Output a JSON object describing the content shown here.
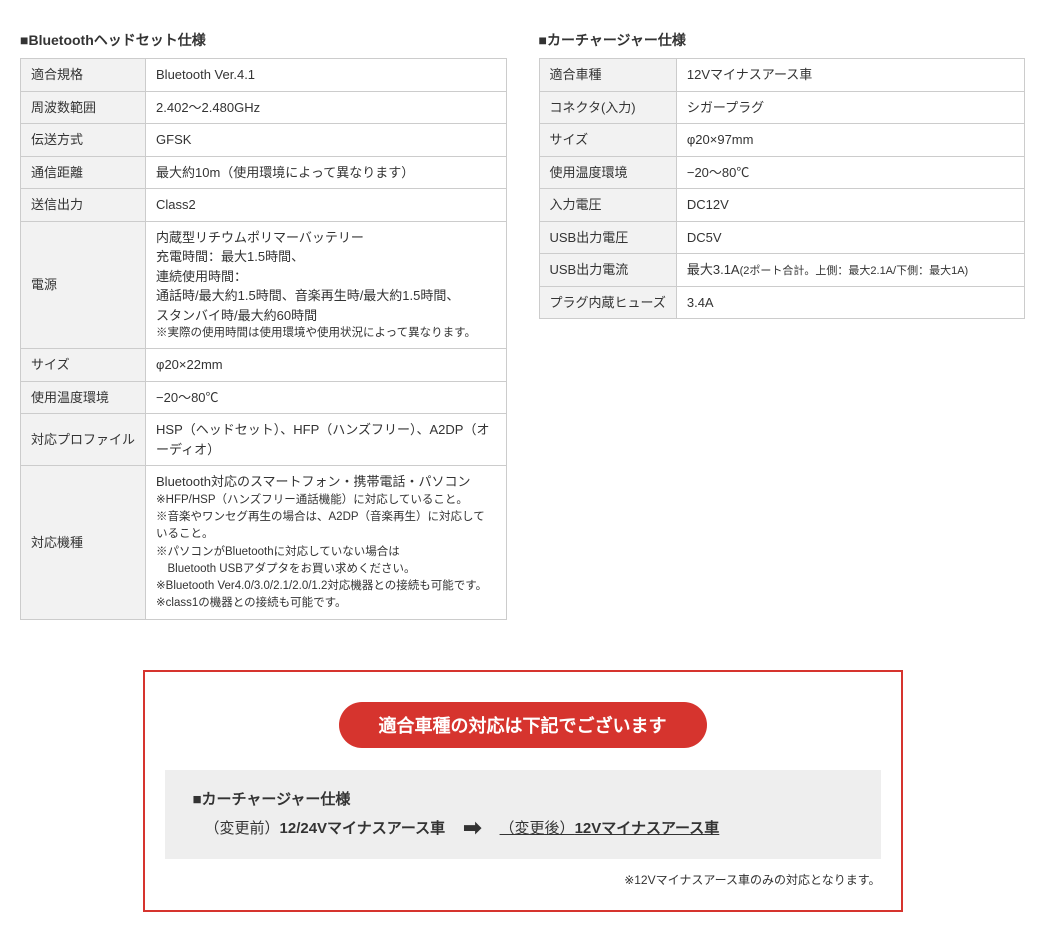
{
  "left": {
    "title": "■Bluetoothヘッドセット仕様",
    "rows": [
      {
        "k": "適合規格",
        "v": "Bluetooth Ver.4.1"
      },
      {
        "k": "周波数範囲",
        "v": "2.402～2.480GHz"
      },
      {
        "k": "伝送方式",
        "v": "GFSK"
      },
      {
        "k": "通信距離",
        "v": "最大約10m（使用環境によって異なります）"
      },
      {
        "k": "送信出力",
        "v": "Class2"
      }
    ],
    "power": {
      "k": "電源",
      "lines": [
        "内蔵型リチウムポリマーバッテリー",
        "充電時間：最大1.5時間、",
        "連続使用時間：",
        "通話時/最大約1.5時間、音楽再生時/最大約1.5時間、",
        "スタンバイ時/最大約60時間"
      ],
      "note": "※実際の使用時間は使用環境や使用状況によって異なります。"
    },
    "rows2": [
      {
        "k": "サイズ",
        "v": "φ20×22mm"
      },
      {
        "k": "使用温度環境",
        "v": "−20～80℃"
      },
      {
        "k": "対応プロファイル",
        "v": "HSP（ヘッドセット）、HFP（ハンズフリー）、A2DP（オーディオ）"
      }
    ],
    "models": {
      "k": "対応機種",
      "main": "Bluetooth対応のスマートフォン・携帯電話・パソコン",
      "notes": [
        "※HFP/HSP（ハンズフリー通話機能）に対応していること。",
        "※音楽やワンセグ再生の場合は、A2DP（音楽再生）に対応していること。",
        "※パソコンがBluetoothに対応していない場合は",
        "　Bluetooth USBアダプタをお買い求めください。",
        "※Bluetooth Ver4.0/3.0/2.1/2.0/1.2対応機器との接続も可能です。",
        "※class1の機器との接続も可能です。"
      ]
    }
  },
  "right": {
    "title": "■カーチャージャー仕様",
    "rows": [
      {
        "k": "適合車種",
        "v": "12Vマイナスアース車"
      },
      {
        "k": "コネクタ(入力)",
        "v": "シガープラグ"
      },
      {
        "k": "サイズ",
        "v": "φ20×97mm"
      },
      {
        "k": "使用温度環境",
        "v": "−20～80℃"
      },
      {
        "k": "入力電圧",
        "v": "DC12V"
      },
      {
        "k": "USB出力電圧",
        "v": "DC5V"
      }
    ],
    "usbCurrent": {
      "k": "USB出力電流",
      "main": "最大3.1A",
      "sub": "(2ポート合計。上側：最大2.1A/下側：最大1A)"
    },
    "fuse": {
      "k": "プラグ内蔵ヒューズ",
      "v": "3.4A"
    }
  },
  "notice": {
    "headline": "適合車種の対応は下記でございます",
    "section_title": "■カーチャージャー仕様",
    "before_label": "（変更前）",
    "before_value": "12/24Vマイナスアース車",
    "arrow": "➡",
    "after_label": "（変更後）",
    "after_value": "12Vマイナスアース車",
    "footnote": "※12Vマイナスアース車のみの対応となります。"
  }
}
